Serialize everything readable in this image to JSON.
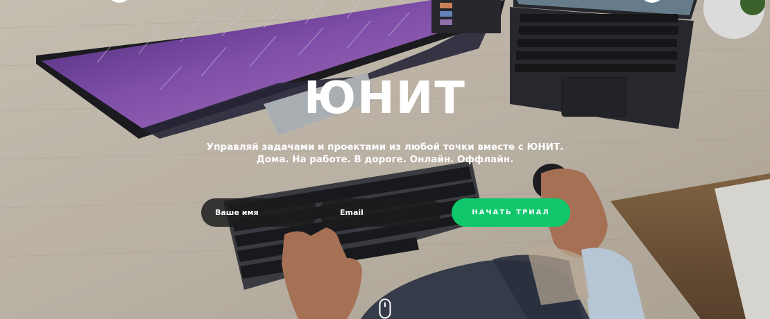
{
  "hero": {
    "title": "ЮНИТ",
    "subtitle_line1": "Управляй задачами и проектами из любой точки вместе с ЮНИТ.",
    "subtitle_line2": "Дома. На работе. В дороге. Онлайн. Оффлайн."
  },
  "form": {
    "name_placeholder": "Ваше имя",
    "email_placeholder": "Email",
    "submit_label": "НАЧАТЬ ТРИАЛ"
  },
  "icons": {
    "scroll": "mouse-scroll-icon"
  },
  "colors": {
    "accent": "#10c86b",
    "input_bg": "#1c1c1c",
    "text": "#ffffff"
  }
}
